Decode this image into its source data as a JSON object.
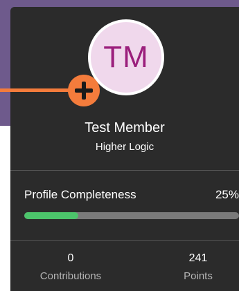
{
  "profile": {
    "initials": "TM",
    "name": "Test Member",
    "organization": "Higher Logic"
  },
  "completeness": {
    "label": "Profile Completeness",
    "value_text": "25%",
    "percent": 25
  },
  "stats": {
    "contributions": {
      "value": "0",
      "label": "Contributions"
    },
    "points": {
      "value": "241",
      "label": "Points"
    }
  },
  "colors": {
    "background_purple": "#6e5a8c",
    "card": "#2b2b2b",
    "avatar_bg": "#f0d8ec",
    "initials": "#9b1f7c",
    "progress_fill": "#4cc46b",
    "progress_track": "#7a7a7a",
    "annotation": "#f47c3c"
  },
  "icons": {
    "add_badge": "plus-icon"
  }
}
